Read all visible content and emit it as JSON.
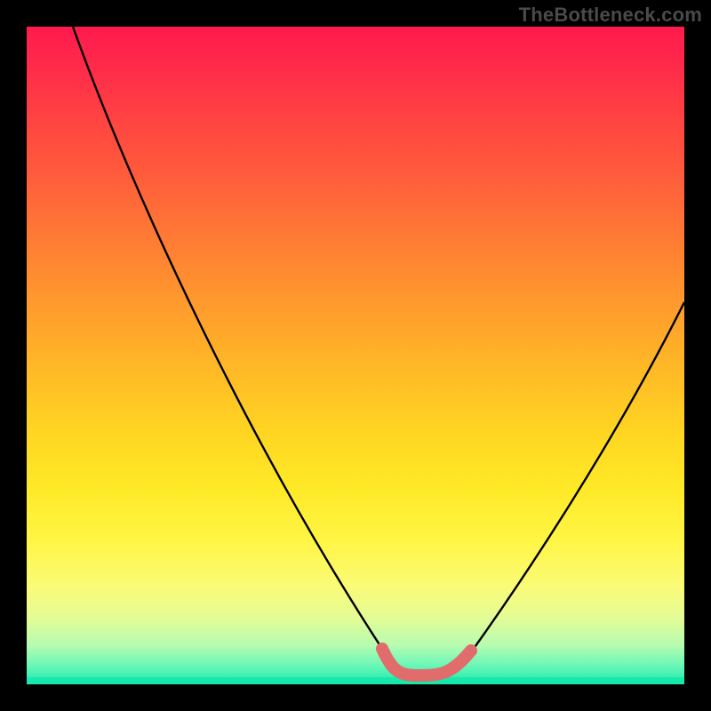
{
  "watermark": "TheBottleneck.com",
  "chart_data": {
    "type": "line",
    "title": "",
    "xlabel": "",
    "ylabel": "",
    "xlim": [
      0,
      100
    ],
    "ylim": [
      0,
      100
    ],
    "grid": false,
    "legend": false,
    "background": {
      "type": "vertical-gradient",
      "stops": [
        {
          "pos": 0,
          "color": "#ff1a4d"
        },
        {
          "pos": 50,
          "color": "#ffbf25"
        },
        {
          "pos": 85,
          "color": "#fbfb76"
        },
        {
          "pos": 100,
          "color": "#1bebae"
        }
      ]
    },
    "series": [
      {
        "name": "bottleneck-curve",
        "color": "#000000",
        "x": [
          7,
          12,
          18,
          24,
          30,
          36,
          42,
          48,
          53,
          56,
          58,
          60,
          62,
          64,
          66,
          68,
          72,
          78,
          85,
          92,
          100
        ],
        "y": [
          100,
          92,
          82,
          72,
          62,
          52,
          42,
          32,
          22,
          14,
          8,
          4,
          2,
          2,
          2,
          4,
          10,
          20,
          32,
          44,
          58
        ]
      },
      {
        "name": "optimal-zone",
        "color": "#e06c6c",
        "x": [
          56,
          58,
          60,
          62,
          64,
          66,
          68
        ],
        "y": [
          4,
          2,
          1.5,
          1.5,
          1.5,
          2,
          4
        ]
      }
    ],
    "annotations": []
  }
}
